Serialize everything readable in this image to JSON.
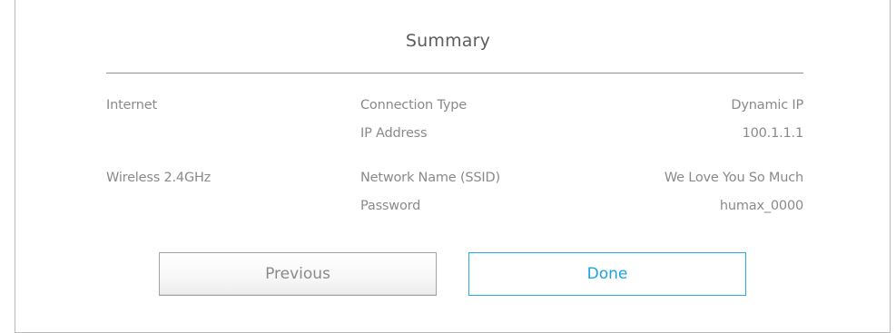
{
  "title": "Summary",
  "sections": [
    {
      "name": "Internet",
      "rows": [
        {
          "label": "Connection Type",
          "value": "Dynamic IP"
        },
        {
          "label": "IP Address",
          "value": "100.1.1.1"
        }
      ]
    },
    {
      "name": "Wireless 2.4GHz",
      "rows": [
        {
          "label": "Network Name (SSID)",
          "value": "We Love You So Much"
        },
        {
          "label": "Password",
          "value": "humax_0000"
        }
      ]
    }
  ],
  "buttons": {
    "previous": "Previous",
    "done": "Done"
  },
  "colors": {
    "accent": "#1aa3dc",
    "text": "#8a8a8a",
    "title": "#5d5d5d"
  }
}
